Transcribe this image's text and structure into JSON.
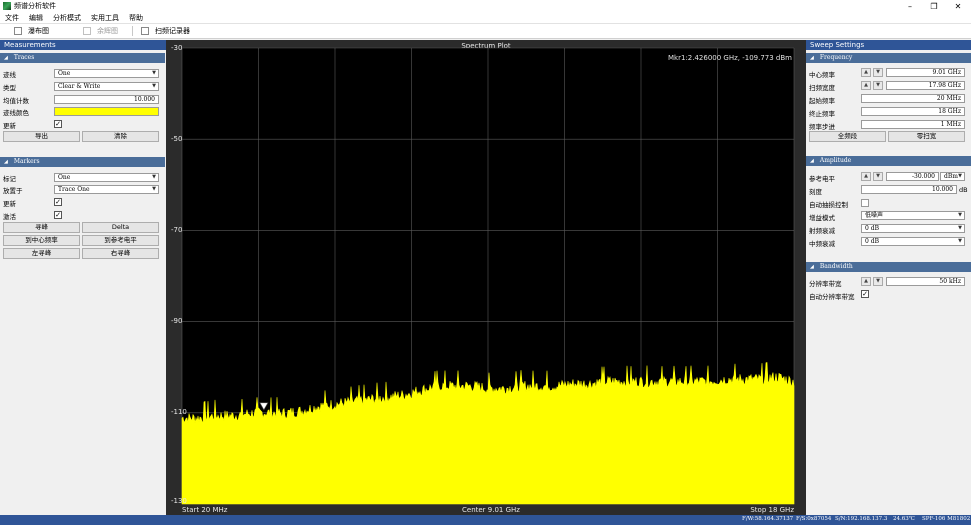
{
  "window": {
    "title": "频谱分析软件",
    "controls": {
      "minimize": "–",
      "restore": "❐",
      "close": "✕"
    }
  },
  "menu": [
    "文件",
    "编辑",
    "分析模式",
    "实用工具",
    "帮助"
  ],
  "toolbar": [
    {
      "label": "瀑布图",
      "checked": false,
      "enabled": true
    },
    {
      "label": "余辉图",
      "checked": false,
      "enabled": false
    },
    {
      "label": "扫频记录器",
      "checked": false,
      "enabled": true
    }
  ],
  "measurements": {
    "title": "Measurements",
    "traces": {
      "header": "Traces",
      "trace_label": "迹线",
      "trace_value": "One",
      "type_label": "类型",
      "type_value": "Clear & Write",
      "avg_label": "均值计数",
      "avg_value": "10.000",
      "color_label": "迹线颜色",
      "color_value": "#ffff00",
      "update_label": "更新",
      "update_checked": true,
      "export_button": "导出",
      "clear_button": "清除"
    },
    "markers": {
      "header": "Markers",
      "marker_label": "标记",
      "marker_value": "One",
      "place_label": "放置于",
      "place_value": "Trace One",
      "update_label": "更新",
      "update_checked": true,
      "active_label": "激活",
      "active_checked": true,
      "peak_button": "寻峰",
      "delta_button": "Delta",
      "to_center_button": "到中心频率",
      "to_ref_button": "到参考电平",
      "peak_left_button": "左寻峰",
      "peak_right_button": "右寻峰"
    }
  },
  "plot": {
    "title": "Spectrum Plot",
    "marker_readout": "Mkr1:2.426000 GHz, -109.773 dBm",
    "y_ticks": [
      "-30",
      "-50",
      "-70",
      "-90",
      "-110",
      "-130"
    ],
    "x_start": "Start 20 MHz",
    "x_center": "Center 9.01 GHz",
    "x_stop": "Stop 18 GHz",
    "trace_color": "#ffff00",
    "grid_color": "#5a5a5a"
  },
  "chart_data": {
    "type": "area",
    "title": "Spectrum Plot",
    "xlabel": "",
    "ylabel": "",
    "x_unit": "GHz",
    "y_unit": "dBm",
    "xlim": [
      0.02,
      18
    ],
    "ylim": [
      -130,
      -30
    ],
    "grid": true,
    "x": [
      0.02,
      0.5,
      1.0,
      1.5,
      2.0,
      2.426,
      3.0,
      3.5,
      4.0,
      4.5,
      5.0,
      5.5,
      6.0,
      6.5,
      7.0,
      7.5,
      8.0,
      8.5,
      9.0,
      9.5,
      10.0,
      10.5,
      11.0,
      11.5,
      12.0,
      12.5,
      13.0,
      13.5,
      14.0,
      14.5,
      15.0,
      15.5,
      16.0,
      16.5,
      17.0,
      17.5,
      18.0
    ],
    "values": [
      -111,
      -111,
      -110.5,
      -110.5,
      -110,
      -109.8,
      -110,
      -109.5,
      -108.5,
      -108,
      -107.5,
      -107,
      -106.5,
      -106,
      -105,
      -104,
      -104,
      -104,
      -104.5,
      -104.5,
      -104,
      -104,
      -104,
      -103.5,
      -103.5,
      -103,
      -103,
      -103,
      -103,
      -103,
      -103,
      -103,
      -102.5,
      -102.5,
      -102.5,
      -102,
      -103
    ],
    "marker": {
      "name": "Mkr1",
      "x": 2.426,
      "y": -109.773
    }
  },
  "sweep": {
    "title": "Sweep Settings",
    "frequency": {
      "header": "Frequency",
      "center_label": "中心频率",
      "center_value": "9.01 GHz",
      "span_label": "扫频宽度",
      "span_value": "17.98 GHz",
      "start_label": "起始频率",
      "start_value": "20 MHz",
      "stop_label": "终止频率",
      "stop_value": "18 GHz",
      "step_label": "频率步进",
      "step_value": "1 MHz",
      "full_span_button": "全频段",
      "zero_span_button": "零扫宽"
    },
    "amplitude": {
      "header": "Amplitude",
      "ref_label": "参考电平",
      "ref_value": "-30.000",
      "ref_unit": "dBm",
      "scale_label": "刻度",
      "scale_value": "10.000",
      "scale_unit": "dB",
      "auto_atten_label": "自动抽损控制",
      "auto_atten_checked": false,
      "gain_mode_label": "增益模式",
      "gain_mode_value": "低噪声",
      "rf_atten_label": "射频衰减",
      "rf_atten_value": "0 dB",
      "if_atten_label": "中频衰减",
      "if_atten_value": "0 dB"
    },
    "bandwidth": {
      "header": "Bandwidth",
      "rbw_label": "分辨率带宽",
      "rbw_value": "50 kHz",
      "auto_rbw_label": "自动分辨率带宽",
      "auto_rbw_checked": true
    }
  },
  "status": {
    "fw": "F/W:58.164.37137",
    "fs": "F/S:0x87054",
    "sn": "S/N:192.168.137.3",
    "temp": "24.63℃",
    "model": "SPF-106 M81802"
  }
}
